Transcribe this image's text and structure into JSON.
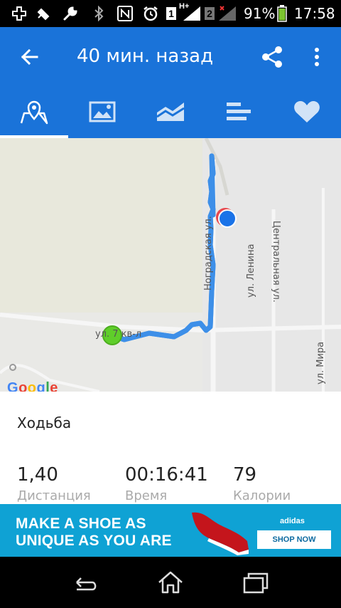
{
  "status_bar": {
    "battery_percent": "91%",
    "time": "17:58",
    "sim1": "1",
    "sim2": "2",
    "network": "H+",
    "icons": [
      "plus-box-icon",
      "satellite-icon",
      "wrench-icon",
      "bluetooth-icon",
      "nfc-icon",
      "alarm-icon",
      "signal-sim1-icon",
      "signal-sim2-icon",
      "battery-icon"
    ]
  },
  "app_bar": {
    "title": "40 мин. назад",
    "back_icon": "arrow-back-icon",
    "share_icon": "share-icon",
    "more_icon": "more-vert-icon",
    "color": "#1a73d9"
  },
  "tabs": [
    {
      "icon": "map-icon",
      "selected": true
    },
    {
      "icon": "photo-icon",
      "selected": false
    },
    {
      "icon": "chart-area-icon",
      "selected": false
    },
    {
      "icon": "bar-list-icon",
      "selected": false
    },
    {
      "icon": "heart-icon",
      "selected": false
    }
  ],
  "map": {
    "labels": {
      "nogradskaya": "Ноградская ул.",
      "lenina": "ул. Ленина",
      "centralnaya": "Центральная ул.",
      "mira": "ул. Мира",
      "street7": "ул. 7 кв-л"
    },
    "google": "Google",
    "route_color": "#3d8fe8",
    "start_color": "#5fce2a",
    "end_color": "#1a73e8"
  },
  "details": {
    "activity": "Ходьба",
    "stats": [
      {
        "value": "1,40",
        "label": "Дистанция"
      },
      {
        "value": "00:16:41",
        "label": "Время"
      },
      {
        "value": "79",
        "label": "Калории"
      }
    ]
  },
  "ad": {
    "line1": "MAKE A SHOE AS",
    "line2": "UNIQUE AS YOU ARE",
    "brand": "adidas",
    "cta": "SHOP NOW",
    "color": "#0fa2d4"
  },
  "nav_bar": {
    "icons": [
      "nav-back-icon",
      "nav-home-icon",
      "nav-recents-icon"
    ]
  }
}
